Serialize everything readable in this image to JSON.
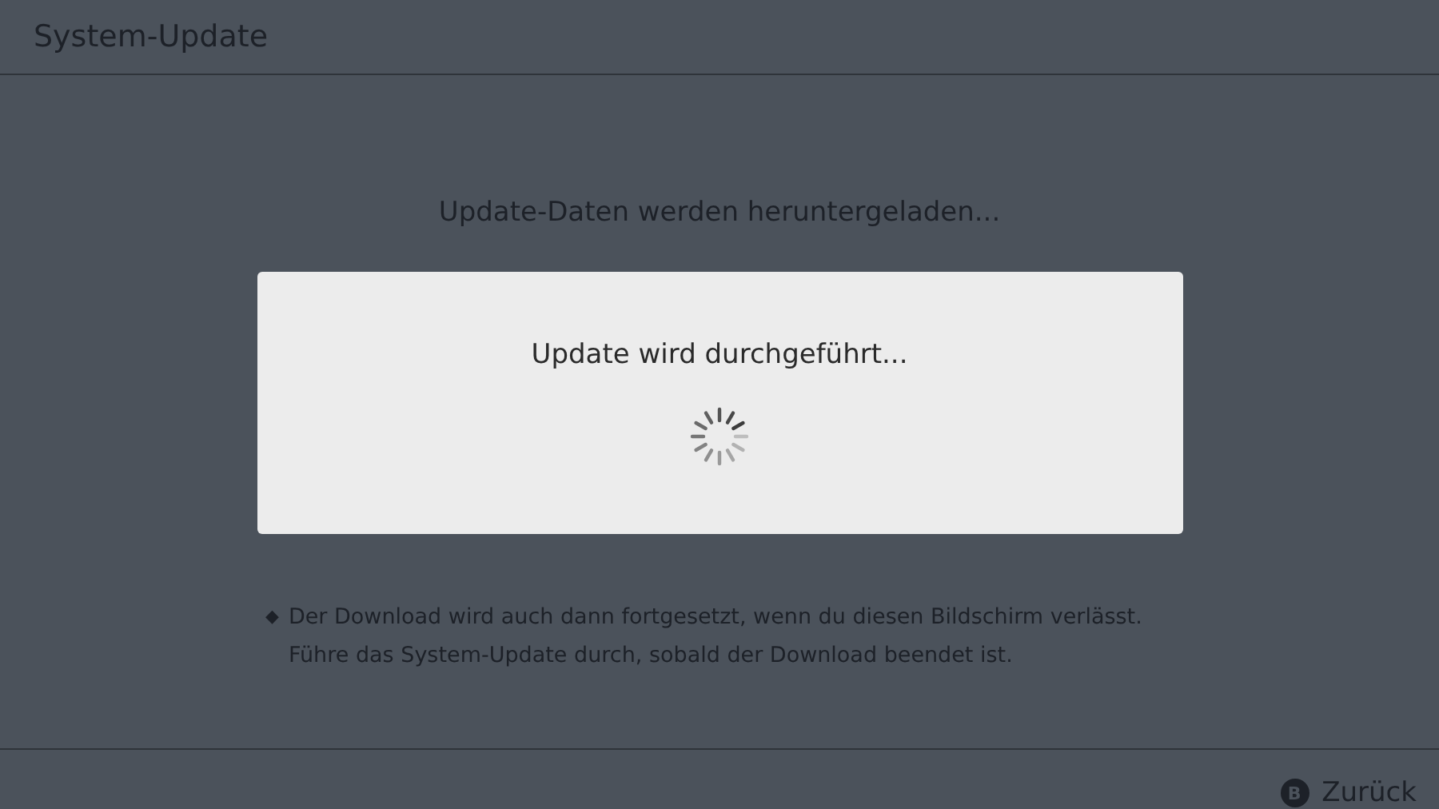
{
  "header": {
    "title": "System-Update"
  },
  "status_message": "Update-Daten werden heruntergeladen...",
  "dialog": {
    "message": "Update wird durchgeführt..."
  },
  "note": {
    "bullet": "◆",
    "text": "Der Download wird auch dann fortgesetzt, wenn du diesen Bildschirm verlässt. Führe das System-Update durch, sobald der Download beendet ist."
  },
  "footer": {
    "back_button": {
      "key": "B",
      "label": "Zurück"
    }
  }
}
